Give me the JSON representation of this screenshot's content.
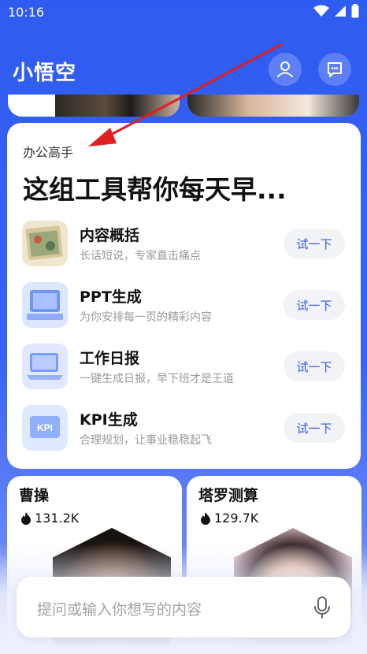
{
  "status_bar": {
    "time": "10:16"
  },
  "header": {
    "title": "小悟空"
  },
  "office_card": {
    "tag": "办公高手",
    "headline": "这组工具帮你每天早...",
    "tools": [
      {
        "name": "内容概括",
        "desc": "长话短说，专家直击痛点",
        "button": "试一下"
      },
      {
        "name": "PPT生成",
        "desc": "为你安排每一页的精彩内容",
        "button": "试一下"
      },
      {
        "name": "工作日报",
        "desc": "一键生成日报，早下班才是王道",
        "button": "试一下"
      },
      {
        "name": "KPI生成",
        "desc": "合理规划，让事业稳稳起飞",
        "button": "试一下"
      }
    ]
  },
  "bottom_cards": [
    {
      "title": "曹操",
      "stat": "131.2K",
      "icon": "fire-icon"
    },
    {
      "title": "塔罗测算",
      "stat": "129.7K",
      "icon": "fire-icon"
    }
  ],
  "input_bar": {
    "placeholder": "提问或输入你想写的内容"
  },
  "colors": {
    "brand_blue": "#3a63f3",
    "arrow_red": "#e02020",
    "button_text": "#3a5bdc"
  }
}
